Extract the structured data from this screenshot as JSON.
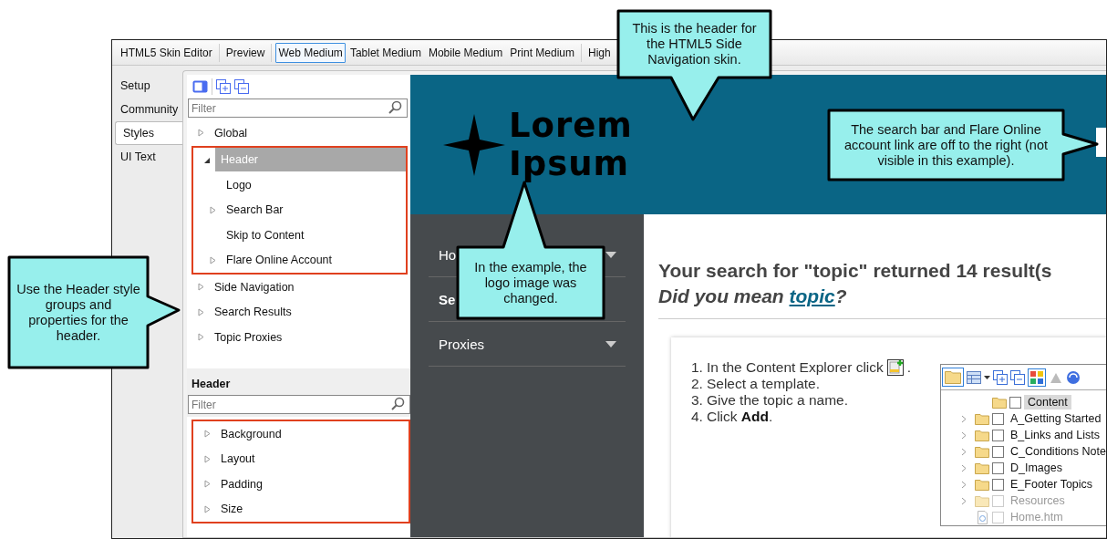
{
  "toolbar": {
    "groups": [
      {
        "items": [
          {
            "label": "HTML5 Skin Editor",
            "selected": false
          }
        ]
      },
      {
        "items": [
          {
            "label": "Preview",
            "selected": false
          }
        ]
      },
      {
        "items": [
          {
            "label": "Web Medium",
            "selected": true
          },
          {
            "label": "Tablet Medium",
            "selected": false
          },
          {
            "label": "Mobile Medium",
            "selected": false
          },
          {
            "label": "Print Medium",
            "selected": false
          }
        ]
      },
      {
        "items": [
          {
            "label": "High",
            "selected": false
          }
        ]
      }
    ]
  },
  "side_tabs": [
    {
      "label": "Setup",
      "selected": false
    },
    {
      "label": "Community",
      "selected": false
    },
    {
      "label": "Styles",
      "selected": true
    },
    {
      "label": "UI Text",
      "selected": false
    }
  ],
  "styles_panel": {
    "filter_placeholder": "Filter",
    "tree": [
      {
        "label": "Global",
        "expanded": false,
        "selected": false
      },
      {
        "label": "Header",
        "expanded": true,
        "selected": true,
        "highlighted": true,
        "children": [
          {
            "label": "Logo",
            "selected": false
          },
          {
            "label": "Search Bar",
            "expanded": false,
            "selected": false
          },
          {
            "label": "Skip to Content",
            "selected": false
          },
          {
            "label": "Flare Online Account",
            "expanded": false,
            "selected": false
          }
        ]
      },
      {
        "label": "Side Navigation",
        "expanded": false,
        "selected": false
      },
      {
        "label": "Search Results",
        "expanded": false,
        "selected": false
      },
      {
        "label": "Topic Proxies",
        "expanded": false,
        "selected": false
      }
    ]
  },
  "properties_panel": {
    "title": "Header",
    "filter_placeholder": "Filter",
    "highlighted": true,
    "items": [
      {
        "label": "Background",
        "expanded": false
      },
      {
        "label": "Layout",
        "expanded": false
      },
      {
        "label": "Padding",
        "expanded": false
      },
      {
        "label": "Size",
        "expanded": false
      }
    ]
  },
  "preview": {
    "logo_lines": [
      "Lorem",
      "Ipsum"
    ],
    "nav": [
      {
        "label": "Ho",
        "selected": false,
        "has_caret": true
      },
      {
        "label": "Se",
        "selected": true,
        "has_caret": false
      },
      {
        "label": "Proxies",
        "selected": false,
        "has_caret": true
      }
    ],
    "results": {
      "heading": "Your search for \"topic\" returned 14 result(s",
      "suggestion_prefix": "Did you mean ",
      "suggestion_link": "topic",
      "suggestion_suffix": "?",
      "steps": [
        {
          "number": "1.",
          "kind": "icon",
          "text": "In the Content Explorer click",
          "after": "."
        },
        {
          "number": "2.",
          "kind": "text",
          "text": "Select a template."
        },
        {
          "number": "3.",
          "kind": "text",
          "text": "Give the topic a name."
        },
        {
          "number": "4.",
          "kind": "text",
          "text": "Click **Add**."
        }
      ],
      "explorer": {
        "root": {
          "label": "Content",
          "selected": true,
          "checked": false
        },
        "items": [
          {
            "label": "A_Getting Started",
            "kind": "folder",
            "disabled": false,
            "checked": false
          },
          {
            "label": "B_Links and Lists",
            "kind": "folder",
            "disabled": false,
            "checked": false
          },
          {
            "label": "C_Conditions Note",
            "kind": "folder",
            "disabled": false,
            "checked": false
          },
          {
            "label": "D_Images",
            "kind": "folder",
            "disabled": false,
            "checked": false
          },
          {
            "label": "E_Footer Topics",
            "kind": "folder",
            "disabled": false,
            "checked": false
          },
          {
            "label": "Resources",
            "kind": "folder",
            "disabled": true,
            "checked": false
          },
          {
            "label": "Home.htm",
            "kind": "file",
            "disabled": true,
            "checked": false
          }
        ]
      }
    }
  },
  "callouts": [
    {
      "text": "This is the header for the HTML5 Side Navigation skin."
    },
    {
      "text": "The search bar and Flare Online account link are off to the right (not visible in this example)."
    },
    {
      "text": "Use the Header style groups and properties for the header."
    },
    {
      "text": "In the example, the logo image was changed."
    }
  ]
}
